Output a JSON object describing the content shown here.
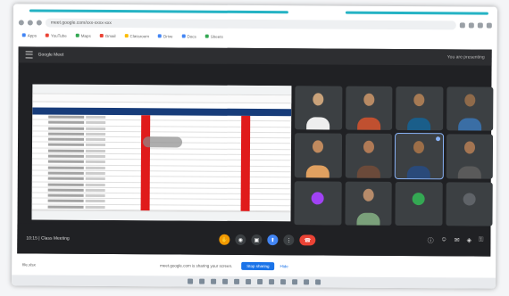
{
  "browser": {
    "url": "meet.google.com/xxx-xxxx-xxx",
    "bookmarks": [
      {
        "label": "Apps",
        "color": "#4285f4"
      },
      {
        "label": "YouTube",
        "color": "#ea4335"
      },
      {
        "label": "Maps",
        "color": "#34a853"
      },
      {
        "label": "Gmail",
        "color": "#ea4335"
      },
      {
        "label": "Classroom",
        "color": "#fbbc04"
      },
      {
        "label": "Drive",
        "color": "#4285f4"
      },
      {
        "label": "Docs",
        "color": "#4285f4"
      },
      {
        "label": "Sheets",
        "color": "#34a853"
      }
    ]
  },
  "meet": {
    "header_title": "Google Meet",
    "header_right": "You are presenting",
    "meeting_time": "10:15 | Class Meeting",
    "tiles": [
      {
        "name": "",
        "skin": "#c9a27a",
        "shirt": "#eeeeee"
      },
      {
        "name": "",
        "skin": "#b88a64",
        "shirt": "#c05030"
      },
      {
        "name": "",
        "skin": "#a67a54",
        "shirt": "#1a5e8a"
      },
      {
        "name": "",
        "skin": "#8f6a4a",
        "shirt": "#3a6ea5"
      },
      {
        "name": "",
        "skin": "#c08a5e",
        "shirt": "#e0a060"
      },
      {
        "name": "",
        "skin": "#b07a56",
        "shirt": "#6b4a3a"
      },
      {
        "name": "",
        "skin": "#9c6e48",
        "shirt": "#2a4a7a",
        "active": true
      },
      {
        "name": "",
        "skin": "#a47552",
        "shirt": "#5a5a5a"
      },
      {
        "name": "",
        "avatar": "#a142f4"
      },
      {
        "name": "",
        "skin": "#b68b6a",
        "shirt": "#7aa07a"
      },
      {
        "name": "",
        "avatar": "#34a853"
      },
      {
        "name": "",
        "avatar": "#5f6368"
      }
    ]
  },
  "sharing": {
    "message": "meet.google.com is sharing your screen.",
    "stop_label": "Stop sharing",
    "hide_label": "Hide",
    "download_label": "file.xlsx"
  },
  "colors": {
    "accent": "#25b3c4",
    "meet_bg": "#202124",
    "sheet_header": "#173c7a",
    "highlight_red": "#e01b1b",
    "end_call": "#ea4335"
  }
}
